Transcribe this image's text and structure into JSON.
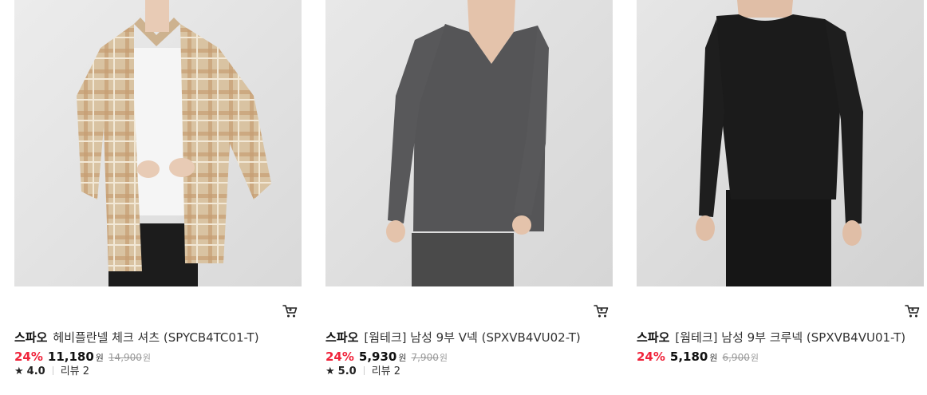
{
  "products": [
    {
      "brand": "스파오",
      "name": "헤비플란넬 체크 셔츠 (SPYCB4TC01-T)",
      "discount": "24%",
      "price": "11,180",
      "currency": "원",
      "original_price": "14,900",
      "original_currency": "원",
      "rating_icon": "star-icon",
      "rating": "4.0",
      "review_label": "리뷰",
      "review_count": "2",
      "image_desc_icon": "product-image",
      "cart_icon": "cart-icon"
    },
    {
      "brand": "스파오",
      "name": "[웜테크] 남성 9부 V넥 (SPXVB4VU02-T)",
      "discount": "24%",
      "price": "5,930",
      "currency": "원",
      "original_price": "7,900",
      "original_currency": "원",
      "rating_icon": "star-icon",
      "rating": "5.0",
      "review_label": "리뷰",
      "review_count": "2",
      "image_desc_icon": "product-image",
      "cart_icon": "cart-icon"
    },
    {
      "brand": "스파오",
      "name": "[웜테크] 남성 9부 크루넥 (SPXVB4VU01-T)",
      "discount": "24%",
      "price": "5,180",
      "currency": "원",
      "original_price": "6,900",
      "original_currency": "원",
      "image_desc_icon": "product-image",
      "cart_icon": "cart-icon"
    }
  ],
  "colors": {
    "discount": "#f0243b",
    "price": "#111111",
    "original_price": "#999999"
  }
}
